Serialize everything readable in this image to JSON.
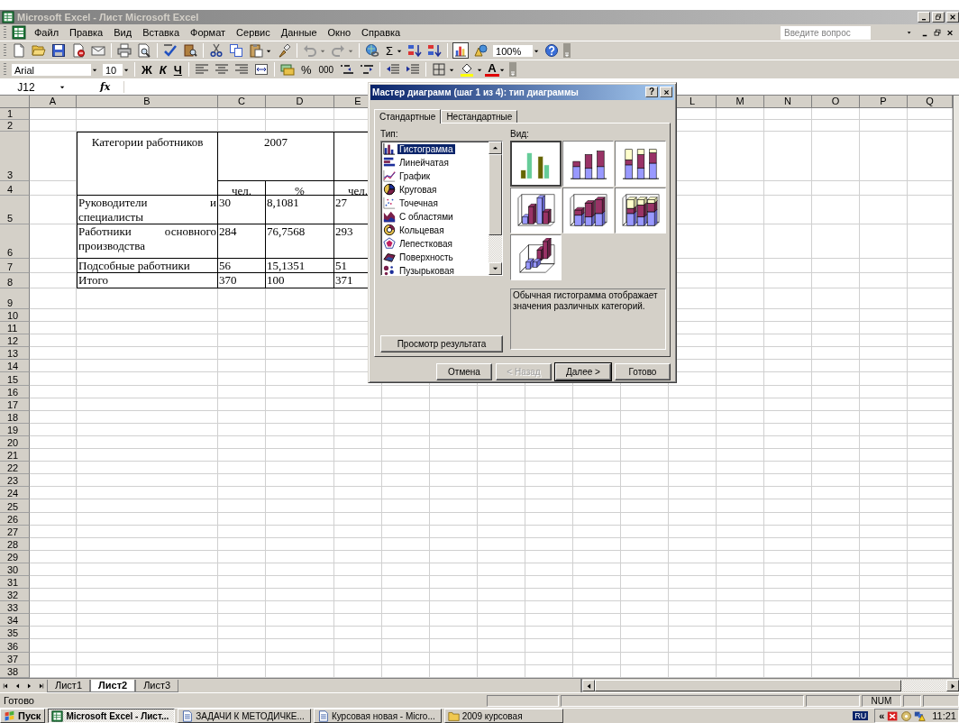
{
  "window": {
    "title": "Microsoft Excel - Лист Microsoft Excel"
  },
  "menu": [
    "Файл",
    "Правка",
    "Вид",
    "Вставка",
    "Формат",
    "Сервис",
    "Данные",
    "Окно",
    "Справка"
  ],
  "question_box": {
    "placeholder": "Введите вопрос"
  },
  "standard_toolbar": {
    "sum_symbol": "Σ",
    "chart_wizard_pressed": true,
    "zoom": "100%"
  },
  "formatting_toolbar": {
    "font": "Arial",
    "size": "10",
    "bold": "Ж",
    "italic": "К",
    "underline": "Ч",
    "percent": "%",
    "thousands": "000",
    "font_color_letter": "A"
  },
  "formula_bar": {
    "cell": "J12",
    "function_symbol": "fx"
  },
  "columns": [
    "A",
    "B",
    "C",
    "D",
    "E",
    "L",
    "M",
    "N",
    "O",
    "P",
    "Q"
  ],
  "rows": [
    "1",
    "2",
    "3",
    "4",
    "5",
    "6",
    "7",
    "8",
    "9",
    "10",
    "11",
    "12",
    "13",
    "14",
    "15",
    "16",
    "17",
    "18",
    "19",
    "20",
    "21",
    "22",
    "23",
    "24",
    "25",
    "26",
    "27",
    "28",
    "29",
    "30",
    "31",
    "32",
    "33",
    "34",
    "35",
    "36",
    "37",
    "38"
  ],
  "table": {
    "category_heading": "Категории работников",
    "year": "2007",
    "units": [
      "чел.",
      "%",
      "чел."
    ],
    "rows": [
      {
        "category": "Руководители и специалисты",
        "values": [
          "30",
          "8,1081",
          "27"
        ]
      },
      {
        "category": "Работники основного производства",
        "values": [
          "284",
          "76,7568",
          "293"
        ]
      },
      {
        "category": "Подсобные работники",
        "values": [
          "56",
          "15,1351",
          "51"
        ]
      },
      {
        "category": "Итого",
        "values": [
          "370",
          "100",
          "371"
        ]
      }
    ]
  },
  "dialog": {
    "title": "Мастер диаграмм (шаг 1 из 4): тип диаграммы",
    "help": "?",
    "tabs": [
      {
        "label": "Стандартные",
        "selected": true
      },
      {
        "label": "Нестандартные",
        "selected": false
      }
    ],
    "type_label": "Тип:",
    "types": [
      {
        "label": "Гистограмма",
        "selected": true
      },
      {
        "label": "Линейчатая",
        "selected": false
      },
      {
        "label": "График",
        "selected": false
      },
      {
        "label": "Круговая",
        "selected": false
      },
      {
        "label": "Точечная",
        "selected": false
      },
      {
        "label": "С областями",
        "selected": false
      },
      {
        "label": "Кольцевая",
        "selected": false
      },
      {
        "label": "Лепестковая",
        "selected": false
      },
      {
        "label": "Поверхность",
        "selected": false
      },
      {
        "label": "Пузырьковая",
        "selected": false
      }
    ],
    "view_label": "Вид:",
    "subtypes": [
      {
        "kind": "clustered",
        "selected": true
      },
      {
        "kind": "stacked",
        "selected": false
      },
      {
        "kind": "percent",
        "selected": false
      },
      {
        "kind": "clustered-3d",
        "selected": false
      },
      {
        "kind": "stacked-3d",
        "selected": false
      },
      {
        "kind": "percent-3d",
        "selected": false
      },
      {
        "kind": "column-3d",
        "selected": false
      }
    ],
    "description": "Обычная гистограмма отображает значения различных категорий.",
    "preview_button": "Просмотр результата",
    "buttons": [
      {
        "label": "Отмена",
        "disabled": false,
        "default": false
      },
      {
        "label": "< Назад",
        "disabled": true,
        "default": false
      },
      {
        "label": "Далее >",
        "disabled": false,
        "default": true
      },
      {
        "label": "Готово",
        "disabled": false,
        "default": false
      }
    ]
  },
  "sheet_tabs": [
    {
      "label": "Лист1",
      "selected": false
    },
    {
      "label": "Лист2",
      "selected": true
    },
    {
      "label": "Лист3",
      "selected": false
    }
  ],
  "status_bar": {
    "text": "Готово",
    "indicator": "NUM"
  },
  "taskbar": {
    "start": "Пуск",
    "tasks": [
      {
        "label": "Microsoft Excel - Лист...",
        "selected": true
      },
      {
        "label": "ЗАДАЧИ К МЕТОДИЧКЕ...",
        "selected": false
      },
      {
        "label": "Курсовая новая - Micro...",
        "selected": false
      },
      {
        "label": "2009 курсовая",
        "selected": false
      }
    ],
    "tray": {
      "language": "RU",
      "expand": "«",
      "clock": "11:21"
    }
  }
}
